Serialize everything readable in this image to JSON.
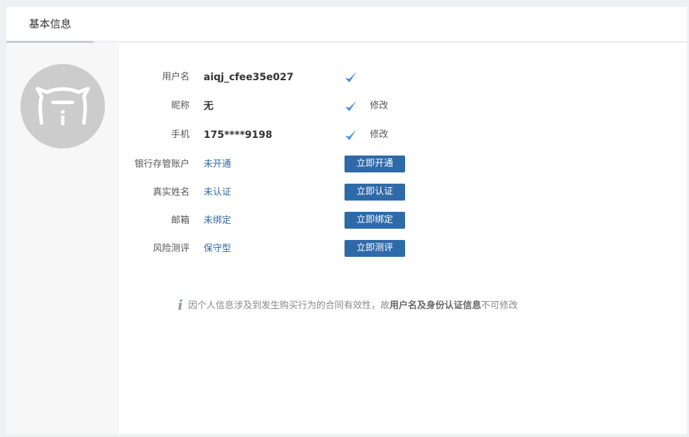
{
  "tab": {
    "label": "基本信息"
  },
  "rows": {
    "username": {
      "label": "用户名",
      "value": "aiqj_cfee35e027"
    },
    "nickname": {
      "label": "昵称",
      "value": "无",
      "action": "修改"
    },
    "phone": {
      "label": "手机",
      "value": "175****9198",
      "action": "修改"
    },
    "bank": {
      "label": "银行存管账户",
      "value": "未开通",
      "button": "立即开通"
    },
    "realname": {
      "label": "真实姓名",
      "value": "未认证",
      "button": "立即认证"
    },
    "email": {
      "label": "邮箱",
      "value": "未绑定",
      "button": "立即绑定"
    },
    "risk": {
      "label": "风险测评",
      "value": "保守型",
      "button": "立即测评"
    }
  },
  "notice": {
    "prefix": "因个人信息涉及到发生购买行为的合同有效性，故",
    "bold": "用户名及身份认证信息",
    "suffix": "不可修改"
  },
  "colors": {
    "accent": "#2f6aa8",
    "check": "#4a90e2",
    "avatar_bg": "#cccccc"
  },
  "icons": {
    "avatar": "cat-avatar-icon",
    "check": "checkmark-icon",
    "info": "info-icon"
  }
}
